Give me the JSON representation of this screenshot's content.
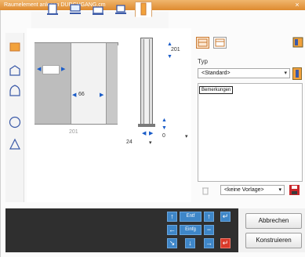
{
  "window": {
    "title": "Raumelement anlegen DURCHGANG.cm",
    "close": "×"
  },
  "tabs": [
    {
      "icon": "door-frame-icon"
    },
    {
      "icon": "window-icon"
    },
    {
      "icon": "opening-icon"
    },
    {
      "icon": "niche-icon"
    },
    {
      "icon": "column-icon"
    }
  ],
  "tools": [
    {
      "icon": "rectangle-icon"
    },
    {
      "icon": "arch-pentagon-icon"
    },
    {
      "icon": "gothic-arch-icon"
    },
    {
      "icon": "circle-icon"
    },
    {
      "icon": "triangle-icon"
    }
  ],
  "canvas": {
    "width_field": "",
    "inner_width": "66",
    "total_width": "201",
    "height_top": "201",
    "sill_value": "0",
    "depth_value": "24"
  },
  "props": {
    "typ_label": "Typ",
    "typ_value": "<Standard>",
    "notes_label": "Bemerkungen",
    "template_value": "<keine Vorlage>"
  },
  "keypad": {
    "delete_label": "Entf",
    "insert_label": "Einfg"
  },
  "buttons": {
    "cancel": "Abbrechen",
    "construct": "Konstruieren"
  },
  "colors": {
    "accent": "#de8a2f",
    "key_blue": "#3e86c8",
    "key_red": "#d93a2a",
    "dark_panel": "#2f2f2f"
  }
}
